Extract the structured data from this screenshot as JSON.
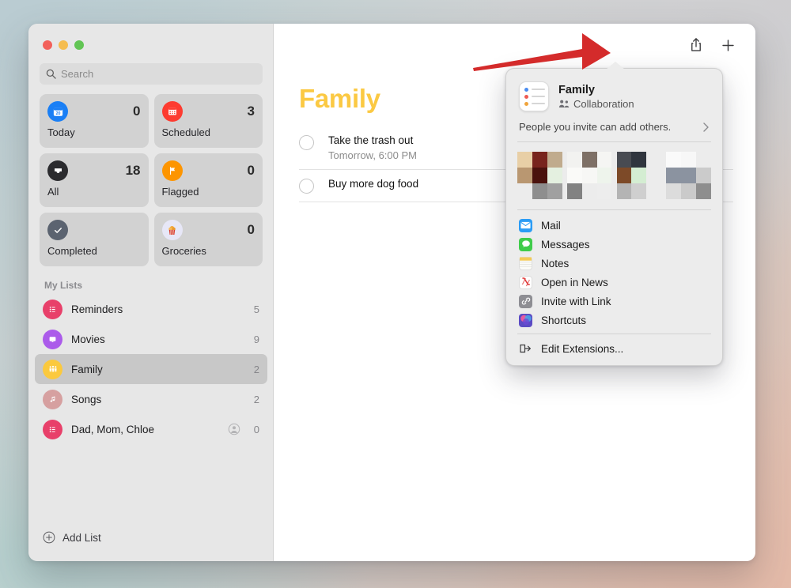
{
  "window": {
    "traffic_lights": [
      "close",
      "minimize",
      "zoom"
    ],
    "accent_color": "#fbc943"
  },
  "sidebar": {
    "search": {
      "placeholder": "Search",
      "icon": "search-icon"
    },
    "smart_lists": [
      {
        "label": "Today",
        "count": "0",
        "icon": "calendar-icon",
        "color": "#1a7ff5"
      },
      {
        "label": "Scheduled",
        "count": "3",
        "icon": "calendar-days-icon",
        "color": "#fd3b30"
      },
      {
        "label": "All",
        "count": "18",
        "icon": "tray-icon",
        "color": "#2b2b2e"
      },
      {
        "label": "Flagged",
        "count": "0",
        "icon": "flag-icon",
        "color": "#fd9500"
      },
      {
        "label": "Completed",
        "count": "",
        "icon": "checkmark-icon",
        "color": "#5b6370"
      },
      {
        "label": "Groceries",
        "count": "0",
        "icon": "groceries-icon",
        "color": "#e7e7f5"
      }
    ],
    "my_lists_header": "My Lists",
    "lists": [
      {
        "label": "Reminders",
        "count": "5",
        "icon": "list-bullet-icon",
        "color": "#e8406a",
        "selected": false,
        "shared": false
      },
      {
        "label": "Movies",
        "count": "9",
        "icon": "display-icon",
        "color": "#ab5bea",
        "selected": false,
        "shared": false
      },
      {
        "label": "Family",
        "count": "2",
        "icon": "people-icon",
        "color": "#fbc93e",
        "selected": true,
        "shared": false
      },
      {
        "label": "Songs",
        "count": "2",
        "icon": "music-note-icon",
        "color": "#d6a0a0",
        "selected": false,
        "shared": false
      },
      {
        "label": "Dad, Mom, Chloe",
        "count": "0",
        "icon": "list-bullet-icon",
        "color": "#e8406a",
        "selected": false,
        "shared": true
      }
    ],
    "add_list": {
      "label": "Add List",
      "icon": "plus-circle-icon"
    }
  },
  "toolbar": {
    "share_button": "share-icon",
    "add_button": "plus-icon"
  },
  "main": {
    "title": "Family",
    "reminders": [
      {
        "title": "Take the trash out",
        "due": "Tomorrow, 6:00 PM"
      },
      {
        "title": "Buy more dog food",
        "due": ""
      }
    ]
  },
  "share_popover": {
    "list_name": "Family",
    "subtitle": "Collaboration",
    "subtitle_icon": "people-two-icon",
    "permission": {
      "text": "People you invite can add others.",
      "chevron": "chevron-right-icon"
    },
    "suggested_contacts": [
      {
        "name": "contact-thumbnail-1"
      },
      {
        "name": "contact-thumbnail-2"
      },
      {
        "name": "contact-thumbnail-3"
      },
      {
        "name": "contact-thumbnail-4"
      }
    ],
    "share_targets": [
      {
        "label": "Mail",
        "icon": "mail-icon",
        "color": "#2b9cf5"
      },
      {
        "label": "Messages",
        "icon": "messages-icon",
        "color": "#3fcc4a"
      },
      {
        "label": "Notes",
        "icon": "notes-icon",
        "color": "#f7cf54"
      },
      {
        "label": "Open in News",
        "icon": "news-icon",
        "color": "#ffffff"
      },
      {
        "label": "Invite with Link",
        "icon": "link-icon",
        "color": "#8e8e93"
      },
      {
        "label": "Shortcuts",
        "icon": "shortcuts-icon",
        "color": "#5b4bc4"
      }
    ],
    "edit_extensions": {
      "label": "Edit Extensions...",
      "icon": "extensions-icon"
    }
  },
  "annotation": {
    "arrow": "red-arrow-pointing-to-share-button",
    "color": "#d32f2f"
  }
}
